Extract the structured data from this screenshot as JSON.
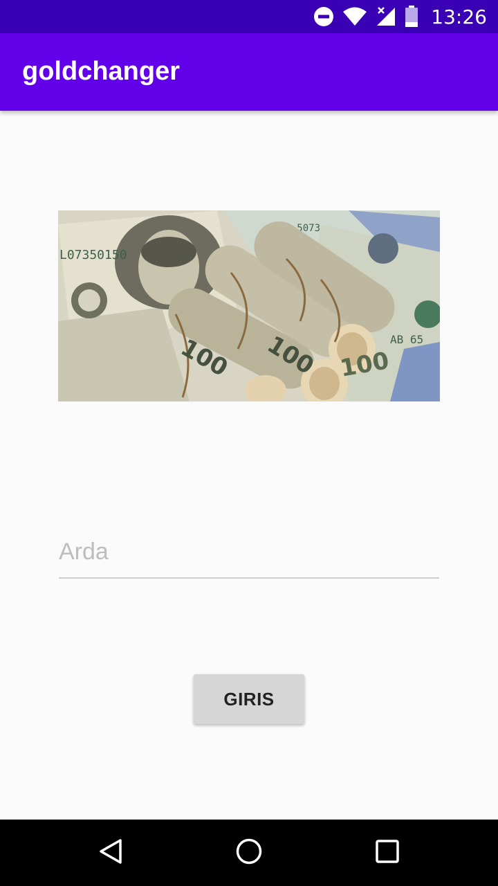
{
  "status_bar": {
    "time": "13:26",
    "icons": [
      "do-not-disturb-icon",
      "wifi-icon",
      "signal-icon",
      "battery-icon"
    ]
  },
  "app_bar": {
    "title": "goldchanger",
    "color": "#6200ea"
  },
  "hero_image": {
    "subject": "rolled-dollar-bills-photo"
  },
  "form": {
    "name_placeholder": "Arda",
    "name_value": "",
    "login_label": "GIRIS"
  },
  "nav_bar": {
    "buttons": [
      "back-icon",
      "home-icon",
      "recents-icon"
    ]
  }
}
